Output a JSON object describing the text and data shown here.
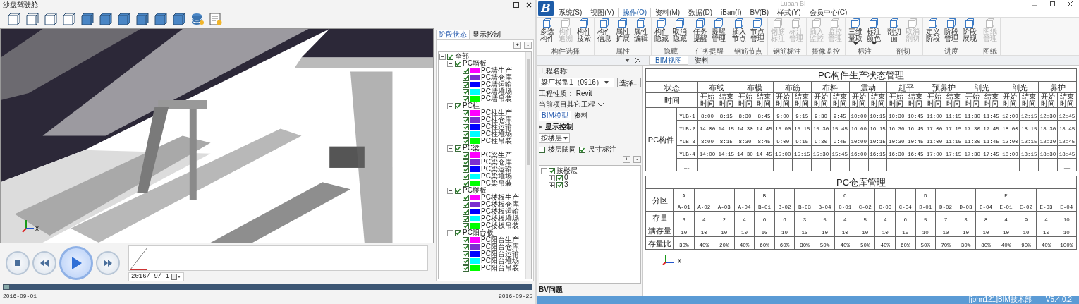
{
  "left_window": {
    "title": "沙盘驾驶舱",
    "viewport": {
      "axis_label": "x"
    },
    "side_panel": {
      "tabs": [
        {
          "label": "阶段状态",
          "selected": true
        },
        {
          "label": "显示控制",
          "selected": false
        }
      ],
      "add_button": "+",
      "remove_button": "-",
      "tree": [
        {
          "label": "全部",
          "checked": true,
          "expanded": true,
          "children": [
            {
              "label": "PC墙板",
              "checked": true,
              "expanded": true,
              "children": [
                {
                  "label": "PC墙生产",
                  "checked": true,
                  "color": "#ff00ff"
                },
                {
                  "label": "PC墙仓库",
                  "checked": true,
                  "color": "#7b2fd0"
                },
                {
                  "label": "PC墙运输",
                  "checked": true,
                  "color": "#0000ff"
                },
                {
                  "label": "PC墙堆场",
                  "checked": true,
                  "color": "#00ffff"
                },
                {
                  "label": "PC墙吊装",
                  "checked": true,
                  "color": "#00ff00"
                }
              ]
            },
            {
              "label": "PC柱",
              "checked": true,
              "expanded": true,
              "children": [
                {
                  "label": "PC柱生产",
                  "checked": true,
                  "color": "#ff00ff"
                },
                {
                  "label": "PC柱仓库",
                  "checked": true,
                  "color": "#7b2fd0"
                },
                {
                  "label": "PC柱运输",
                  "checked": true,
                  "color": "#0000ff"
                },
                {
                  "label": "PC柱堆场",
                  "checked": true,
                  "color": "#00ffff"
                },
                {
                  "label": "PC柱吊装",
                  "checked": true,
                  "color": "#00ff00"
                }
              ]
            },
            {
              "label": "PC梁",
              "checked": true,
              "expanded": true,
              "children": [
                {
                  "label": "PC梁生产",
                  "checked": true,
                  "color": "#ff00ff"
                },
                {
                  "label": "PC梁仓库",
                  "checked": true,
                  "color": "#7b2fd0"
                },
                {
                  "label": "PC梁运输",
                  "checked": true,
                  "color": "#0000ff"
                },
                {
                  "label": "PC梁堆场",
                  "checked": true,
                  "color": "#00ffff"
                },
                {
                  "label": "PC梁吊装",
                  "checked": true,
                  "color": "#00ff00"
                }
              ]
            },
            {
              "label": "PC楼板",
              "checked": true,
              "expanded": true,
              "children": [
                {
                  "label": "PC楼板生产",
                  "checked": true,
                  "color": "#ff00ff"
                },
                {
                  "label": "PC楼板仓库",
                  "checked": true,
                  "color": "#7b2fd0"
                },
                {
                  "label": "PC楼板运输",
                  "checked": true,
                  "color": "#0000ff"
                },
                {
                  "label": "PC楼板堆场",
                  "checked": true,
                  "color": "#00ffff"
                },
                {
                  "label": "PC楼板吊装",
                  "checked": true,
                  "color": "#00ff00"
                }
              ]
            },
            {
              "label": "PC阳台板",
              "checked": true,
              "expanded": true,
              "children": [
                {
                  "label": "PC阳台生产",
                  "checked": true,
                  "color": "#ff00ff"
                },
                {
                  "label": "PC阳台仓库",
                  "checked": true,
                  "color": "#7b2fd0"
                },
                {
                  "label": "PC阳台运输",
                  "checked": true,
                  "color": "#0000ff"
                },
                {
                  "label": "PC阳台堆场",
                  "checked": true,
                  "color": "#00ffff"
                },
                {
                  "label": "PC阳台吊装",
                  "checked": true,
                  "color": "#00ff00"
                }
              ]
            }
          ]
        }
      ]
    },
    "timeline": {
      "date": "2016/ 9/ 1",
      "start_label": "2016-09-01",
      "end_label": "2016-09-25",
      "level": 0
    }
  },
  "app": {
    "logo": "B",
    "title": "Luban BI",
    "menu": [
      {
        "label": "系统(S)",
        "selected": false
      },
      {
        "label": "视图(V)",
        "selected": false
      },
      {
        "label": "操作(O)",
        "selected": true
      },
      {
        "label": "资料(M)",
        "selected": false
      },
      {
        "label": "数据(D)",
        "selected": false
      },
      {
        "label": "iBan(I)",
        "selected": false
      },
      {
        "label": "BV(B)",
        "selected": false
      },
      {
        "label": "样式(Y)",
        "selected": false
      },
      {
        "label": "会员中心(C)",
        "selected": false
      }
    ],
    "ribbon": [
      {
        "label": "构件选择",
        "buttons": [
          {
            "label": "多选构件",
            "disabled": false
          },
          {
            "label": "构件追溯",
            "disabled": true
          },
          {
            "label": "构件搜索",
            "disabled": false
          }
        ]
      },
      {
        "label": "属性",
        "buttons": [
          {
            "label": "构件信息",
            "disabled": false
          },
          {
            "label": "属性扩展",
            "disabled": false
          },
          {
            "label": "属性编辑",
            "disabled": false
          }
        ]
      },
      {
        "label": "隐藏",
        "buttons": [
          {
            "label": "构件隐藏",
            "disabled": false
          },
          {
            "label": "取消隐藏",
            "disabled": false
          }
        ]
      },
      {
        "label": "任务提醒",
        "buttons": [
          {
            "label": "任务提醒",
            "disabled": false
          },
          {
            "label": "提醒管理",
            "disabled": false
          }
        ]
      },
      {
        "label": "钢筋节点",
        "buttons": [
          {
            "label": "插入节点",
            "disabled": false
          },
          {
            "label": "节点管理",
            "disabled": false
          }
        ]
      },
      {
        "label": "钢筋标注",
        "buttons": [
          {
            "label": "钢筋标注",
            "disabled": true
          },
          {
            "label": "标注管理",
            "disabled": true
          }
        ]
      },
      {
        "label": "摄像监控",
        "buttons": [
          {
            "label": "插入监控",
            "disabled": true
          },
          {
            "label": "监控管理",
            "disabled": true
          }
        ]
      },
      {
        "label": "标注",
        "buttons": [
          {
            "label": "三维量取",
            "disabled": false,
            "has_menu": true
          },
          {
            "label": "标注颜色",
            "disabled": false,
            "has_menu": true
          }
        ]
      },
      {
        "label": "剖切",
        "buttons": [
          {
            "label": "剖切面",
            "disabled": false
          },
          {
            "label": "取消剖切",
            "disabled": true
          }
        ]
      },
      {
        "label": "进度",
        "buttons": [
          {
            "label": "定义阶段",
            "disabled": false
          },
          {
            "label": "阶段管理",
            "disabled": false
          },
          {
            "label": "阶段展现",
            "disabled": false
          }
        ]
      },
      {
        "label": "图纸",
        "buttons": [
          {
            "label": "图纸管理",
            "disabled": true
          }
        ]
      }
    ],
    "panel": {
      "project_label": "工程名称:",
      "project_value": "梁厂模型1（0916）",
      "choose_button": "选择...",
      "nature": "工程性质： Revit",
      "other_projects": "当前项目其它工程",
      "tabs": [
        {
          "label": "BIM模型",
          "selected": true
        },
        {
          "label": "资料",
          "selected": false
        }
      ],
      "section": "显示控制",
      "floor_select": "按楼层",
      "options": [
        {
          "label": "楼层随同",
          "checked": false
        },
        {
          "label": "尺寸标注",
          "checked": true
        }
      ],
      "add_button": "+",
      "remove_button": "-",
      "tree": [
        {
          "label": "按楼层",
          "checked": true,
          "expanded": true,
          "children": [
            {
              "label": "0",
              "checked": true,
              "expanded": false
            },
            {
              "label": "3",
              "checked": true,
              "expanded": false
            }
          ]
        }
      ],
      "footer": "BV问题"
    },
    "doc_tabs": [
      {
        "label": "BIM视图",
        "selected": true
      },
      {
        "label": "资料",
        "selected": false
      }
    ],
    "production_table": {
      "title": "PC构件生产状态管理",
      "state_label": "状态",
      "time_label": "时间",
      "group_label": "PC构件",
      "stages": [
        "布线",
        "布模",
        "布筋",
        "布料",
        "震动",
        "赶平",
        "预养护",
        "剖光",
        "剖光",
        "养护"
      ],
      "sub_headers": [
        "开始时间",
        "结束时间",
        "开始时间",
        "结束时间",
        "开始时间",
        "结束时间",
        "开始时间",
        "结束时间",
        "开始时间",
        "结束时间",
        "开始时间",
        "结束时间",
        "开始时间",
        "结束时间",
        "开始时间",
        "结束时间",
        "开始时间",
        "结束时间",
        "开始时间",
        "结束时间"
      ],
      "rows": [
        {
          "label": "YLB-1",
          "cells": [
            "8:00",
            "8:15",
            "8:30",
            "8:45",
            "9:00",
            "9:15",
            "9:30",
            "9:45",
            "10:00",
            "10:15",
            "10:30",
            "10:45",
            "11:00",
            "11:15",
            "11:30",
            "11:45",
            "12:00",
            "12:15",
            "12:30",
            "12:45"
          ]
        },
        {
          "label": "YLB-2",
          "cells": [
            "14:00",
            "14:15",
            "14:30",
            "14:45",
            "15:00",
            "15:15",
            "15:30",
            "15:45",
            "16:00",
            "16:15",
            "16:30",
            "16:45",
            "17:00",
            "17:15",
            "17:30",
            "17:45",
            "18:00",
            "18:15",
            "18:30",
            "18:45"
          ]
        },
        {
          "label": "YLB-3",
          "cells": [
            "8:00",
            "8:15",
            "8:30",
            "8:45",
            "9:00",
            "9:15",
            "9:30",
            "9:45",
            "10:00",
            "10:15",
            "10:30",
            "10:45",
            "11:00",
            "11:15",
            "11:30",
            "11:45",
            "12:00",
            "12:15",
            "12:30",
            "12:45"
          ]
        },
        {
          "label": "YLB-4",
          "cells": [
            "14:00",
            "14:15",
            "14:30",
            "14:45",
            "15:00",
            "15:15",
            "15:30",
            "15:45",
            "16:00",
            "16:15",
            "16:30",
            "16:45",
            "17:00",
            "17:15",
            "17:30",
            "17:45",
            "18:00",
            "18:15",
            "18:30",
            "18:45"
          ]
        },
        {
          "label": "……",
          "last_cell": "……"
        }
      ]
    },
    "warehouse_table": {
      "title": "PC仓库管理",
      "zone_label": "分区",
      "stock_label": "存量",
      "capacity_label": "满存量",
      "ratio_label": "存量比",
      "columns": [
        {
          "zone": "A",
          "code": "A-01",
          "stock": "3",
          "capacity": "10",
          "ratio": "30%"
        },
        {
          "code": "A-02",
          "stock": "4",
          "capacity": "10",
          "ratio": "40%"
        },
        {
          "code": "A-03",
          "stock": "2",
          "capacity": "10",
          "ratio": "20%"
        },
        {
          "code": "A-04",
          "stock": "4",
          "capacity": "10",
          "ratio": "40%"
        },
        {
          "zone": "B",
          "code": "B-01",
          "stock": "6",
          "capacity": "10",
          "ratio": "60%"
        },
        {
          "code": "B-02",
          "stock": "6",
          "capacity": "10",
          "ratio": "60%"
        },
        {
          "code": "B-03",
          "stock": "3",
          "capacity": "10",
          "ratio": "30%"
        },
        {
          "code": "B-04",
          "stock": "5",
          "capacity": "10",
          "ratio": "50%"
        },
        {
          "zone": "C",
          "code": "C-01",
          "stock": "4",
          "capacity": "10",
          "ratio": "40%"
        },
        {
          "code": "C-02",
          "stock": "5",
          "capacity": "10",
          "ratio": "50%"
        },
        {
          "code": "C-03",
          "stock": "4",
          "capacity": "10",
          "ratio": "40%"
        },
        {
          "code": "C-04",
          "stock": "6",
          "capacity": "10",
          "ratio": "60%"
        },
        {
          "zone": "D",
          "code": "D-01",
          "stock": "5",
          "capacity": "10",
          "ratio": "50%"
        },
        {
          "code": "D-02",
          "stock": "7",
          "capacity": "10",
          "ratio": "70%"
        },
        {
          "code": "D-03",
          "stock": "3",
          "capacity": "10",
          "ratio": "30%"
        },
        {
          "code": "D-04",
          "stock": "8",
          "capacity": "10",
          "ratio": "80%"
        },
        {
          "zone": "E",
          "code": "E-01",
          "stock": "4",
          "capacity": "10",
          "ratio": "40%"
        },
        {
          "code": "E-02",
          "stock": "9",
          "capacity": "10",
          "ratio": "90%"
        },
        {
          "code": "E-03",
          "stock": "4",
          "capacity": "10",
          "ratio": "40%"
        },
        {
          "code": "E-04",
          "stock": "10",
          "capacity": "10",
          "ratio": "100%"
        }
      ]
    },
    "axis_label": "x",
    "status_bar": {
      "user": "[john121]BIM技术部",
      "version": "V5.4.0.2"
    }
  }
}
